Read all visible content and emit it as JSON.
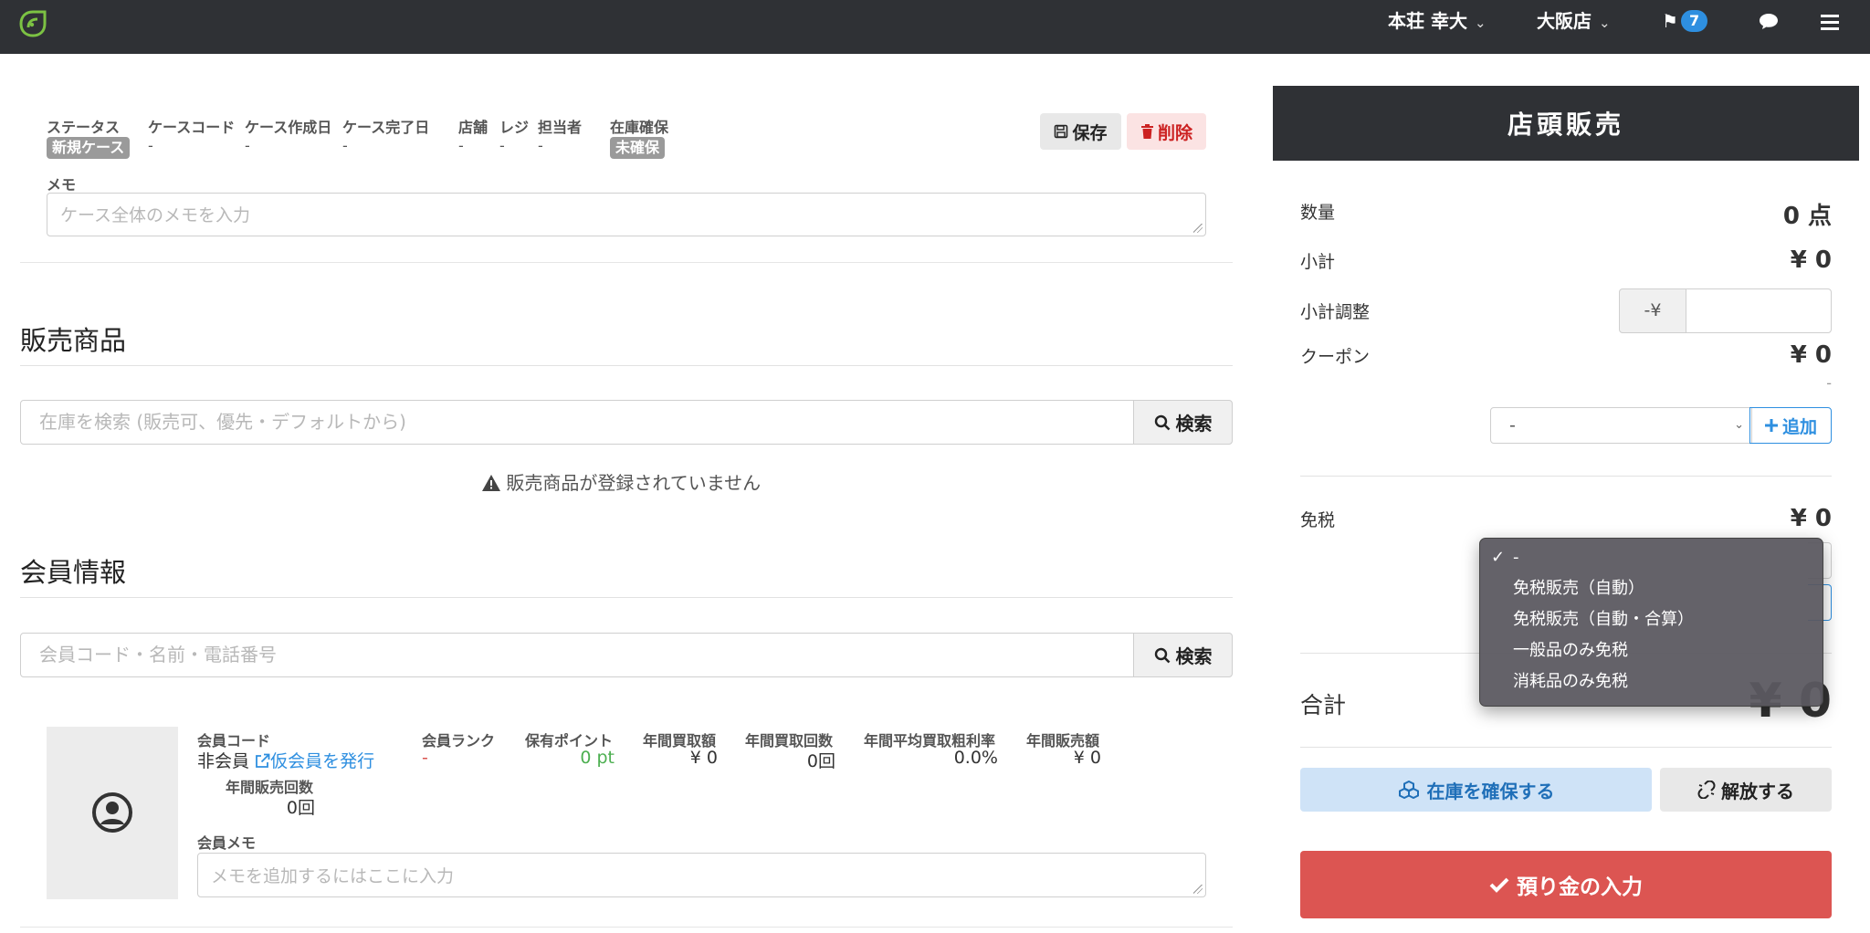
{
  "nav": {
    "user": "本荘 幸大",
    "store": "大阪店",
    "flag_count": "7"
  },
  "case": {
    "labels": [
      "ステータス",
      "ケースコード",
      "ケース作成日",
      "ケース完了日",
      "店舗",
      "レジ",
      "担当者",
      "在庫確保"
    ],
    "status": "新規ケース",
    "code": "-",
    "created": "-",
    "completed": "-",
    "store": "-",
    "register": "-",
    "staff": "-",
    "stock": "未確保",
    "save_label": "保存",
    "delete_label": "削除",
    "memo_label": "メモ",
    "memo_placeholder": "ケース全体のメモを入力"
  },
  "sales": {
    "title": "販売商品",
    "search_placeholder": "在庫を検索 (販売可、優先・デフォルトから)",
    "search_button": "検索",
    "empty_message": "販売商品が登録されていません"
  },
  "member": {
    "title": "会員情報",
    "search_placeholder": "会員コード・名前・電話番号",
    "search_button": "検索",
    "code_label": "会員コード",
    "code_value": "非会員",
    "issue_link": "仮会員を発行",
    "rank_label": "会員ランク",
    "rank_value": "-",
    "points_label": "保有ポイント",
    "points_value": "0 pt",
    "annual_buy_amount_label": "年間買取額",
    "annual_buy_amount_value": "¥ 0",
    "annual_buy_count_label": "年間買取回数",
    "annual_buy_count_value": "0回",
    "margin_label": "年間平均買取粗利率",
    "margin_value": "0.0%",
    "annual_sales_label": "年間販売額",
    "annual_sales_value": "¥ 0",
    "annual_sales_count_label": "年間販売回数",
    "annual_sales_count_value": "0回",
    "memo_label": "会員メモ",
    "memo_placeholder": "メモを追加するにはここに入力"
  },
  "panel": {
    "title": "店頭販売",
    "quantity_label": "数量",
    "quantity_value": "0 点",
    "subtotal_label": "小計",
    "subtotal_value": "¥ 0",
    "adjust_label": "小計調整",
    "adjust_prefix": "-¥",
    "coupon_label": "クーポン",
    "coupon_value": "¥ 0",
    "coupon_sub": "-",
    "coupon_select": "-",
    "add_label": "追加",
    "tax_label": "免税",
    "tax_value": "¥ 0",
    "tax_options": [
      "-",
      "免税販売（自動）",
      "免税販売（自動・合算）",
      "一般品のみ免税",
      "消耗品のみ免税"
    ],
    "total_label": "合計",
    "total_partial": "¥ 0",
    "reserve_label": "在庫を確保する",
    "release_label": "解放する",
    "deposit_label": "預り金の入力"
  },
  "colors": {
    "nav_bg": "#2f3135",
    "accent_blue": "#2e8fe0",
    "danger": "#dc5552",
    "points_green": "#4caf50"
  }
}
